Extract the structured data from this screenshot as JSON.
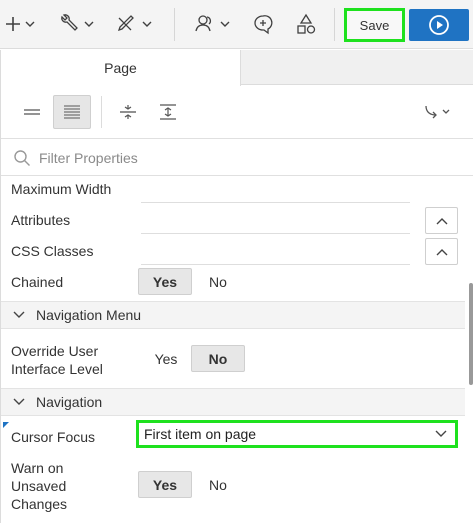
{
  "toolbar": {
    "save_label": "Save"
  },
  "tabs": {
    "page_label": "Page"
  },
  "filter": {
    "placeholder": "Filter Properties"
  },
  "properties": {
    "maximum_width_label": "Maximum Width",
    "attributes_label": "Attributes",
    "css_classes_label": "CSS Classes",
    "chained_label": "Chained",
    "chained_yes": "Yes",
    "chained_no": "No",
    "chained_value": "Yes",
    "navigation_menu_group": "Navigation Menu",
    "override_label_line1": "Override User",
    "override_label_line2": "Interface Level",
    "override_yes": "Yes",
    "override_no": "No",
    "override_value": "No",
    "navigation_group": "Navigation",
    "cursor_focus_label": "Cursor Focus",
    "cursor_focus_value": "First item on page",
    "warn_label_line1": "Warn on",
    "warn_label_line2": "Unsaved",
    "warn_label_line3": "Changes",
    "warn_yes": "Yes",
    "warn_no": "No",
    "warn_value": "Yes"
  },
  "colors": {
    "highlight": "#1ee11e",
    "run_button": "#1f73c3"
  }
}
